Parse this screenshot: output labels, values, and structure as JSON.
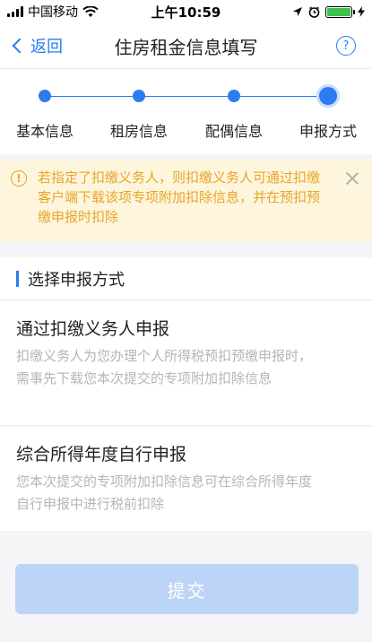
{
  "status_bar": {
    "carrier": "中国移动",
    "time": "上午10:59",
    "battery_color": "#3cc14b"
  },
  "nav": {
    "back_label": "返回",
    "title": "住房租金信息填写",
    "help_label": "?"
  },
  "steps": [
    {
      "label": "基本信息",
      "state": "done"
    },
    {
      "label": "租房信息",
      "state": "done"
    },
    {
      "label": "配偶信息",
      "state": "done"
    },
    {
      "label": "申报方式",
      "state": "current"
    }
  ],
  "notice": {
    "icon": "!",
    "text": "若指定了扣缴义务人，则扣缴义务人可通过扣缴客户端下载该项专项附加扣除信息，并在预扣预缴申报时扣除"
  },
  "section": {
    "title": "选择申报方式"
  },
  "options": [
    {
      "title": "通过扣缴义务人申报",
      "description": "扣缴义务人为您办理个人所得税预扣预缴申报时，需事先下载您本次提交的专项附加扣除信息"
    },
    {
      "title": "综合所得年度自行申报",
      "description": "您本次提交的专项附加扣除信息可在综合所得年度自行申报中进行税前扣除"
    }
  ],
  "submit": {
    "label": "提交"
  },
  "colors": {
    "accent": "#2b7cf0",
    "notice_text": "#e9a52b",
    "notice_bg": "#fdf5dc",
    "disabled_button": "#bcd4f6"
  }
}
